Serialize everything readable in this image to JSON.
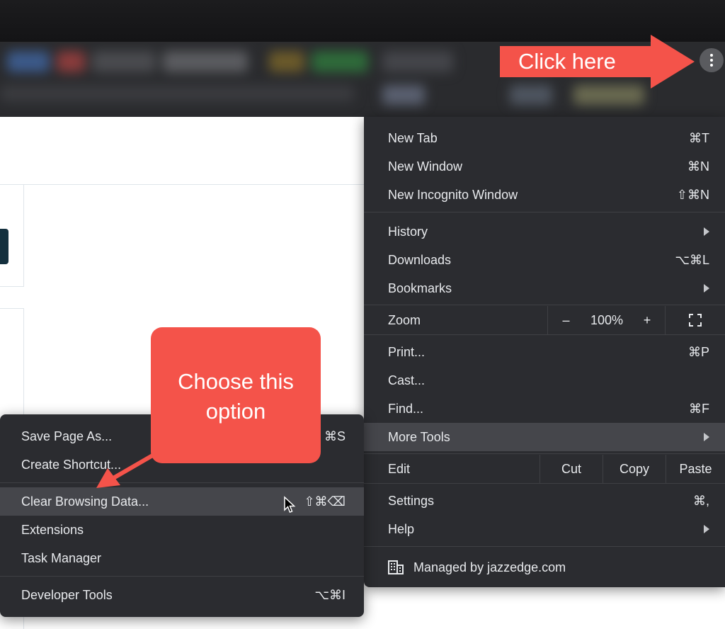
{
  "colors": {
    "menu_bg": "#2b2c30",
    "menu_highlight": "#45464b",
    "menu_text": "#e8eaed",
    "annotation": "#f4534a",
    "toolbar_bg": "#2a2b2e"
  },
  "toolbar": {
    "menu_button_icon": "kebab-icon"
  },
  "annotations": {
    "click_here": "Click here",
    "choose_line1": "Choose this",
    "choose_line2": "option"
  },
  "main_menu": {
    "new_tab": {
      "label": "New Tab",
      "shortcut": "⌘T"
    },
    "new_window": {
      "label": "New Window",
      "shortcut": "⌘N"
    },
    "new_incognito": {
      "label": "New Incognito Window",
      "shortcut": "⇧⌘N"
    },
    "history": {
      "label": "History"
    },
    "downloads": {
      "label": "Downloads",
      "shortcut": "⌥⌘L"
    },
    "bookmarks": {
      "label": "Bookmarks"
    },
    "zoom": {
      "label": "Zoom",
      "minus": "–",
      "value": "100%",
      "plus": "+",
      "fullscreen_icon": "fullscreen-icon"
    },
    "print": {
      "label": "Print...",
      "shortcut": "⌘P"
    },
    "cast": {
      "label": "Cast..."
    },
    "find": {
      "label": "Find...",
      "shortcut": "⌘F"
    },
    "more_tools": {
      "label": "More Tools"
    },
    "edit": {
      "label": "Edit",
      "cut": "Cut",
      "copy": "Copy",
      "paste": "Paste"
    },
    "settings": {
      "label": "Settings",
      "shortcut": "⌘,"
    },
    "help": {
      "label": "Help"
    },
    "managed": {
      "label": "Managed by jazzedge.com",
      "icon": "building-icon"
    }
  },
  "more_tools_menu": {
    "save_page": {
      "label": "Save Page As...",
      "shortcut": "⌘S"
    },
    "create_shortcut": {
      "label": "Create Shortcut..."
    },
    "clear_browsing": {
      "label": "Clear Browsing Data...",
      "shortcut": "⇧⌘⌫"
    },
    "extensions": {
      "label": "Extensions"
    },
    "task_manager": {
      "label": "Task Manager"
    },
    "developer_tools": {
      "label": "Developer Tools",
      "shortcut": "⌥⌘I"
    }
  }
}
